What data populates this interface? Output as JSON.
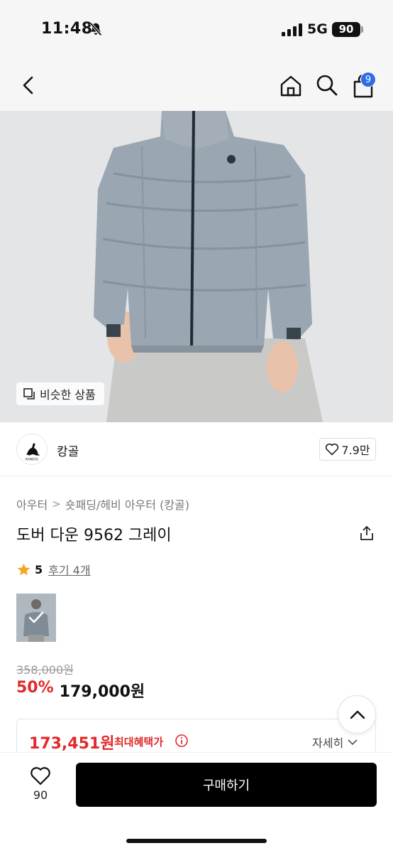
{
  "status_bar": {
    "time": "11:48",
    "network": "5G",
    "battery": "90"
  },
  "nav": {
    "cart_count": "9"
  },
  "hero": {
    "similar_label": "비슷한 상품"
  },
  "brand": {
    "name": "캉골",
    "logo_text": "KANGOL",
    "likes": "7.9만"
  },
  "breadcrumb": {
    "level1": "아우터",
    "separator": ">",
    "level2": "숏패딩/헤비 아우터 (캉골)"
  },
  "product": {
    "title": "도버 다운 9562 그레이"
  },
  "rating": {
    "score": "5",
    "reviews": "후기 4개"
  },
  "price": {
    "original": "358,000원",
    "discount": "50%",
    "sale": "179,000원"
  },
  "benefit": {
    "price": "173,451원",
    "label": "최대혜택가",
    "detail": "자세히"
  },
  "bottom_bar": {
    "like_count": "90",
    "buy_label": "구매하기"
  },
  "colors": {
    "accent_red": "#e12a2a",
    "badge_blue": "#2b6de8",
    "buy_button": "#000000"
  },
  "icons": [
    "back-icon",
    "home-icon",
    "search-icon",
    "cart-icon",
    "similar-icon",
    "heart-icon",
    "share-icon",
    "star-icon",
    "info-icon",
    "chevron-down-icon",
    "chevron-up-icon"
  ]
}
